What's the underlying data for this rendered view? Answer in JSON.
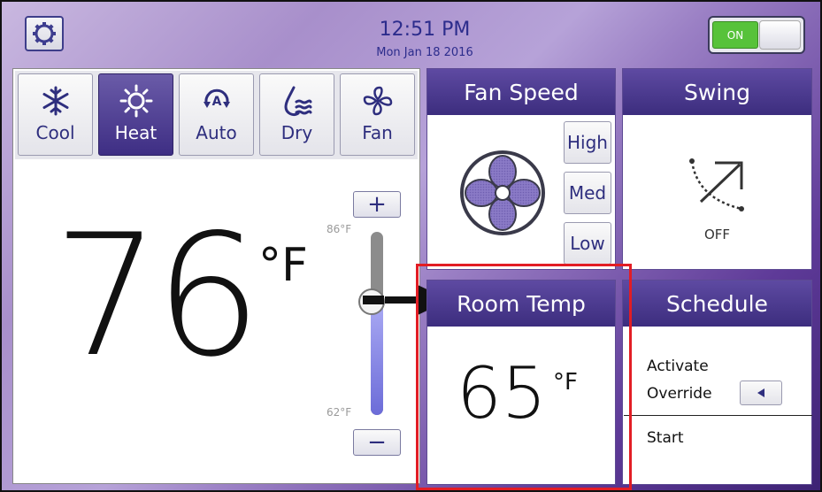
{
  "header": {
    "time": "12:51 PM",
    "date": "Mon Jan 18 2016",
    "power_toggle": "ON",
    "settings_icon": "gear-icon"
  },
  "modes": [
    {
      "label": "Cool",
      "icon": "snowflake-icon",
      "active": false
    },
    {
      "label": "Heat",
      "icon": "sun-icon",
      "active": true
    },
    {
      "label": "Auto",
      "icon": "auto-icon",
      "active": false
    },
    {
      "label": "Dry",
      "icon": "dry-icon",
      "active": false
    },
    {
      "label": "Fan",
      "icon": "fan-icon",
      "active": false
    }
  ],
  "setpoint": {
    "value": "76",
    "unit": "°F",
    "max_label": "86°F",
    "min_label": "62°F",
    "increase_label": "+",
    "decrease_label": "−",
    "level_fraction": 0.58
  },
  "fan_speed": {
    "title": "Fan Speed",
    "options": [
      "High",
      "Med",
      "Low"
    ]
  },
  "swing": {
    "title": "Swing",
    "status": "OFF"
  },
  "room_temp": {
    "title": "Room Temp",
    "value": "65",
    "unit": "°F"
  },
  "schedule": {
    "title": "Schedule",
    "activate_line1": "Activate",
    "activate_line2": "Override",
    "start_label": "Start"
  },
  "colors": {
    "header_purple": "#4b3a91",
    "accent_text": "#2c2c8c",
    "on_green": "#57c23a",
    "highlight_red": "#e21d24"
  }
}
